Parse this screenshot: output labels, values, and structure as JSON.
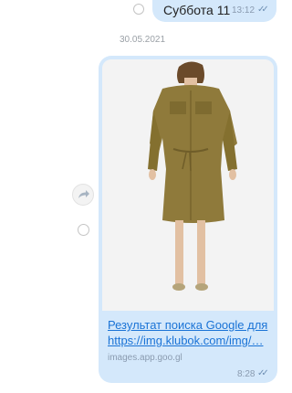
{
  "messages": [
    {
      "text": "Суббота 11",
      "time": "13:12",
      "status_icon": "double-check-icon"
    },
    {
      "date_separator": "30.05.2021",
      "image_alt": "woman in olive shirt dress",
      "link_line1": "Результат поиска Google для",
      "link_line2": "https://img.klubok.com/img/…",
      "domain": "images.app.goo.gl",
      "time": "8:28",
      "status_icon": "double-check-icon"
    }
  ],
  "icons": {
    "share": "share-icon",
    "select": "circle-select-icon"
  },
  "colors": {
    "bubble": "#d4e8fb",
    "link": "#1a73d6",
    "dress": "#8f7a3b"
  }
}
